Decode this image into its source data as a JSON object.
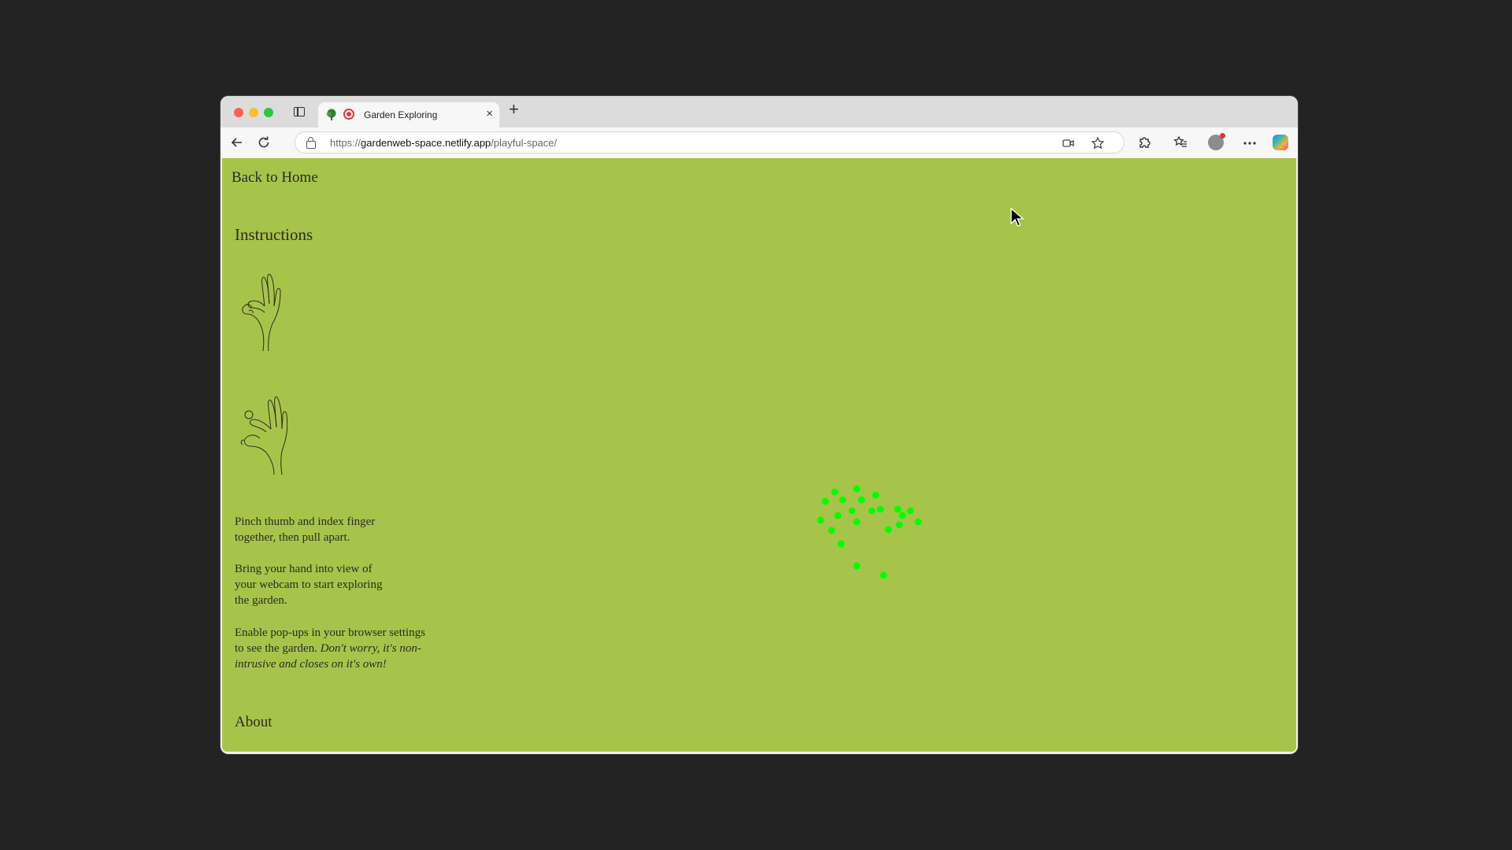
{
  "browser": {
    "tab": {
      "title": "Garden Exploring",
      "close": "×"
    },
    "new_tab": "+",
    "address": {
      "url_scheme": "https://",
      "url_host": "gardenweb-space.netlify.app",
      "url_path": "/playful-space/"
    },
    "icons": {
      "back": "arrow-left-icon",
      "reload": "reload-icon",
      "camera": "camera-icon",
      "star": "star-icon",
      "extensions": "puzzle-icon",
      "favorites": "favorites-icon",
      "more": "more-icon"
    }
  },
  "page": {
    "background_color": "#a7c44a",
    "back_link": "Back to Home",
    "instructions_title": "Instructions",
    "paragraph1": "Pinch thumb and index finger together, then pull apart.",
    "paragraph2": "Bring your hand into view of your webcam to start exploring the garden.",
    "paragraph3_plain": "Enable pop-ups in your browser settings to see the garden. ",
    "paragraph3_italic": "Don't worry, it's non-intrusive and closes on it's own!",
    "about": "About",
    "hand_landmark_color": "#00ff00"
  }
}
